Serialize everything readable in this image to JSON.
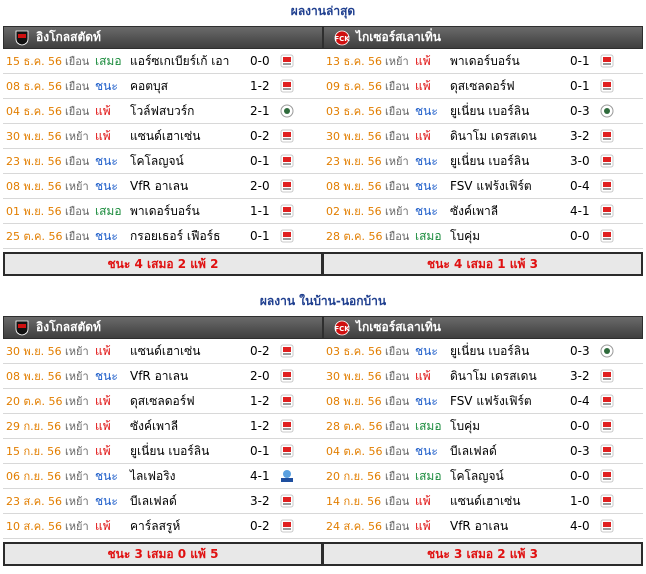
{
  "sections": [
    {
      "title": "ผลงานล่าสุด",
      "left": {
        "team": "อิงโกลสตัดท์",
        "summary": "ชนะ 4 เสมอ 2 แพ้ 2",
        "rows": [
          {
            "date": "15 ธ.ค. 56",
            "venue": "เยือน",
            "result": "เสมอ",
            "rtype": "draw",
            "opponent": "แอร์ซเกเบียร์เก้ เอา",
            "score": "0-0",
            "comp": "bundesliga2-icon"
          },
          {
            "date": "08 ธ.ค. 56",
            "venue": "เยือน",
            "result": "ชนะ",
            "rtype": "win",
            "opponent": "คอตบุส",
            "score": "1-2",
            "comp": "bundesliga2-icon"
          },
          {
            "date": "04 ธ.ค. 56",
            "venue": "เยือน",
            "result": "แพ้",
            "rtype": "loss",
            "opponent": "โวล์ฟสบวร์ก",
            "score": "2-1",
            "comp": "dfb-pokal-icon"
          },
          {
            "date": "30 พ.ย. 56",
            "venue": "เหย้า",
            "result": "แพ้",
            "rtype": "loss",
            "opponent": "แซนด์เฮาเซ่น",
            "score": "0-2",
            "comp": "bundesliga2-icon"
          },
          {
            "date": "23 พ.ย. 56",
            "venue": "เยือน",
            "result": "ชนะ",
            "rtype": "win",
            "opponent": "โคโลญจน์",
            "score": "0-1",
            "comp": "bundesliga2-icon"
          },
          {
            "date": "08 พ.ย. 56",
            "venue": "เหย้า",
            "result": "ชนะ",
            "rtype": "win",
            "opponent": "VfR อาเลน",
            "score": "2-0",
            "comp": "bundesliga2-icon"
          },
          {
            "date": "01 พ.ย. 56",
            "venue": "เยือน",
            "result": "เสมอ",
            "rtype": "draw",
            "opponent": "พาเดอร์บอร์น",
            "score": "1-1",
            "comp": "bundesliga2-icon"
          },
          {
            "date": "25 ต.ค. 56",
            "venue": "เยือน",
            "result": "ชนะ",
            "rtype": "win",
            "opponent": "กรอยเธอร์ เฟือร์ธ",
            "score": "0-1",
            "comp": "bundesliga2-icon"
          }
        ]
      },
      "right": {
        "team": "ไกเซอร์สเลาเทิ่น",
        "summary": "ชนะ 4 เสมอ 1 แพ้ 3",
        "rows": [
          {
            "date": "13 ธ.ค. 56",
            "venue": "เหย้า",
            "result": "แพ้",
            "rtype": "loss",
            "opponent": "พาเดอร์บอร์น",
            "score": "0-1",
            "comp": "bundesliga2-icon"
          },
          {
            "date": "09 ธ.ค. 56",
            "venue": "เยือน",
            "result": "แพ้",
            "rtype": "loss",
            "opponent": "ดุสเซลดอร์ฟ",
            "score": "0-1",
            "comp": "bundesliga2-icon"
          },
          {
            "date": "03 ธ.ค. 56",
            "venue": "เยือน",
            "result": "ชนะ",
            "rtype": "win",
            "opponent": "ยูเนี่ยน เบอร์ลิน",
            "score": "0-3",
            "comp": "dfb-pokal-icon"
          },
          {
            "date": "30 พ.ย. 56",
            "venue": "เยือน",
            "result": "แพ้",
            "rtype": "loss",
            "opponent": "ดินาโม เดรสเดน",
            "score": "3-2",
            "comp": "bundesliga2-icon"
          },
          {
            "date": "23 พ.ย. 56",
            "venue": "เหย้า",
            "result": "ชนะ",
            "rtype": "win",
            "opponent": "ยูเนี่ยน เบอร์ลิน",
            "score": "3-0",
            "comp": "bundesliga2-icon"
          },
          {
            "date": "08 พ.ย. 56",
            "venue": "เยือน",
            "result": "ชนะ",
            "rtype": "win",
            "opponent": "FSV แฟร้งเฟิร์ต",
            "score": "0-4",
            "comp": "bundesliga2-icon"
          },
          {
            "date": "02 พ.ย. 56",
            "venue": "เหย้า",
            "result": "ชนะ",
            "rtype": "win",
            "opponent": "ซังค์เพาลี",
            "score": "4-1",
            "comp": "bundesliga2-icon"
          },
          {
            "date": "28 ต.ค. 56",
            "venue": "เยือน",
            "result": "เสมอ",
            "rtype": "draw",
            "opponent": "โบคุ่ม",
            "score": "0-0",
            "comp": "bundesliga2-icon"
          }
        ]
      }
    },
    {
      "title": "ผลงาน ในบ้าน-นอกบ้าน",
      "left": {
        "team": "อิงโกลสตัดท์",
        "summary": "ชนะ 3 เสมอ 0 แพ้ 5",
        "rows": [
          {
            "date": "30 พ.ย. 56",
            "venue": "เหย้า",
            "result": "แพ้",
            "rtype": "loss",
            "opponent": "แซนด์เฮาเซ่น",
            "score": "0-2",
            "comp": "bundesliga2-icon"
          },
          {
            "date": "08 พ.ย. 56",
            "venue": "เหย้า",
            "result": "ชนะ",
            "rtype": "win",
            "opponent": "VfR อาเลน",
            "score": "2-0",
            "comp": "bundesliga2-icon"
          },
          {
            "date": "20 ต.ค. 56",
            "venue": "เหย้า",
            "result": "แพ้",
            "rtype": "loss",
            "opponent": "ดุสเซลดอร์ฟ",
            "score": "1-2",
            "comp": "bundesliga2-icon"
          },
          {
            "date": "29 ก.ย. 56",
            "venue": "เหย้า",
            "result": "แพ้",
            "rtype": "loss",
            "opponent": "ซังค์เพาลี",
            "score": "1-2",
            "comp": "bundesliga2-icon"
          },
          {
            "date": "15 ก.ย. 56",
            "venue": "เหย้า",
            "result": "แพ้",
            "rtype": "loss",
            "opponent": "ยูเนี่ยน เบอร์ลิน",
            "score": "0-1",
            "comp": "bundesliga2-icon"
          },
          {
            "date": "06 ก.ย. 56",
            "venue": "เหย้า",
            "result": "ชนะ",
            "rtype": "win",
            "opponent": "ไลเฟอริง",
            "score": "4-1",
            "comp": "fifa-friendly-icon"
          },
          {
            "date": "23 ส.ค. 56",
            "venue": "เหย้า",
            "result": "ชนะ",
            "rtype": "win",
            "opponent": "บีเลเฟลด์",
            "score": "3-2",
            "comp": "bundesliga2-icon"
          },
          {
            "date": "10 ส.ค. 56",
            "venue": "เหย้า",
            "result": "แพ้",
            "rtype": "loss",
            "opponent": "คาร์ลสรูห์",
            "score": "0-2",
            "comp": "bundesliga2-icon"
          }
        ]
      },
      "right": {
        "team": "ไกเซอร์สเลาเทิ่น",
        "summary": "ชนะ 3 เสมอ 2 แพ้ 3",
        "rows": [
          {
            "date": "03 ธ.ค. 56",
            "venue": "เยือน",
            "result": "ชนะ",
            "rtype": "win",
            "opponent": "ยูเนี่ยน เบอร์ลิน",
            "score": "0-3",
            "comp": "dfb-pokal-icon"
          },
          {
            "date": "30 พ.ย. 56",
            "venue": "เยือน",
            "result": "แพ้",
            "rtype": "loss",
            "opponent": "ดินาโม เดรสเดน",
            "score": "3-2",
            "comp": "bundesliga2-icon"
          },
          {
            "date": "08 พ.ย. 56",
            "venue": "เยือน",
            "result": "ชนะ",
            "rtype": "win",
            "opponent": "FSV แฟร้งเฟิร์ต",
            "score": "0-4",
            "comp": "bundesliga2-icon"
          },
          {
            "date": "28 ต.ค. 56",
            "venue": "เยือน",
            "result": "เสมอ",
            "rtype": "draw",
            "opponent": "โบคุ่ม",
            "score": "0-0",
            "comp": "bundesliga2-icon"
          },
          {
            "date": "04 ต.ค. 56",
            "venue": "เยือน",
            "result": "ชนะ",
            "rtype": "win",
            "opponent": "บีเลเฟลด์",
            "score": "0-3",
            "comp": "bundesliga2-icon"
          },
          {
            "date": "20 ก.ย. 56",
            "venue": "เยือน",
            "result": "เสมอ",
            "rtype": "draw",
            "opponent": "โคโลญจน์",
            "score": "0-0",
            "comp": "bundesliga2-icon"
          },
          {
            "date": "14 ก.ย. 56",
            "venue": "เยือน",
            "result": "แพ้",
            "rtype": "loss",
            "opponent": "แซนด์เฮาเซ่น",
            "score": "1-0",
            "comp": "bundesliga2-icon"
          },
          {
            "date": "24 ส.ค. 56",
            "venue": "เยือน",
            "result": "แพ้",
            "rtype": "loss",
            "opponent": "VfR อาเลน",
            "score": "4-0",
            "comp": "bundesliga2-icon"
          }
        ]
      }
    }
  ],
  "colors": {
    "date": "#e27e00",
    "win": "#1a5bc9",
    "draw": "#1a8b3c",
    "loss": "#e01010",
    "title": "#1f3f8f",
    "summary": "#e01010"
  }
}
